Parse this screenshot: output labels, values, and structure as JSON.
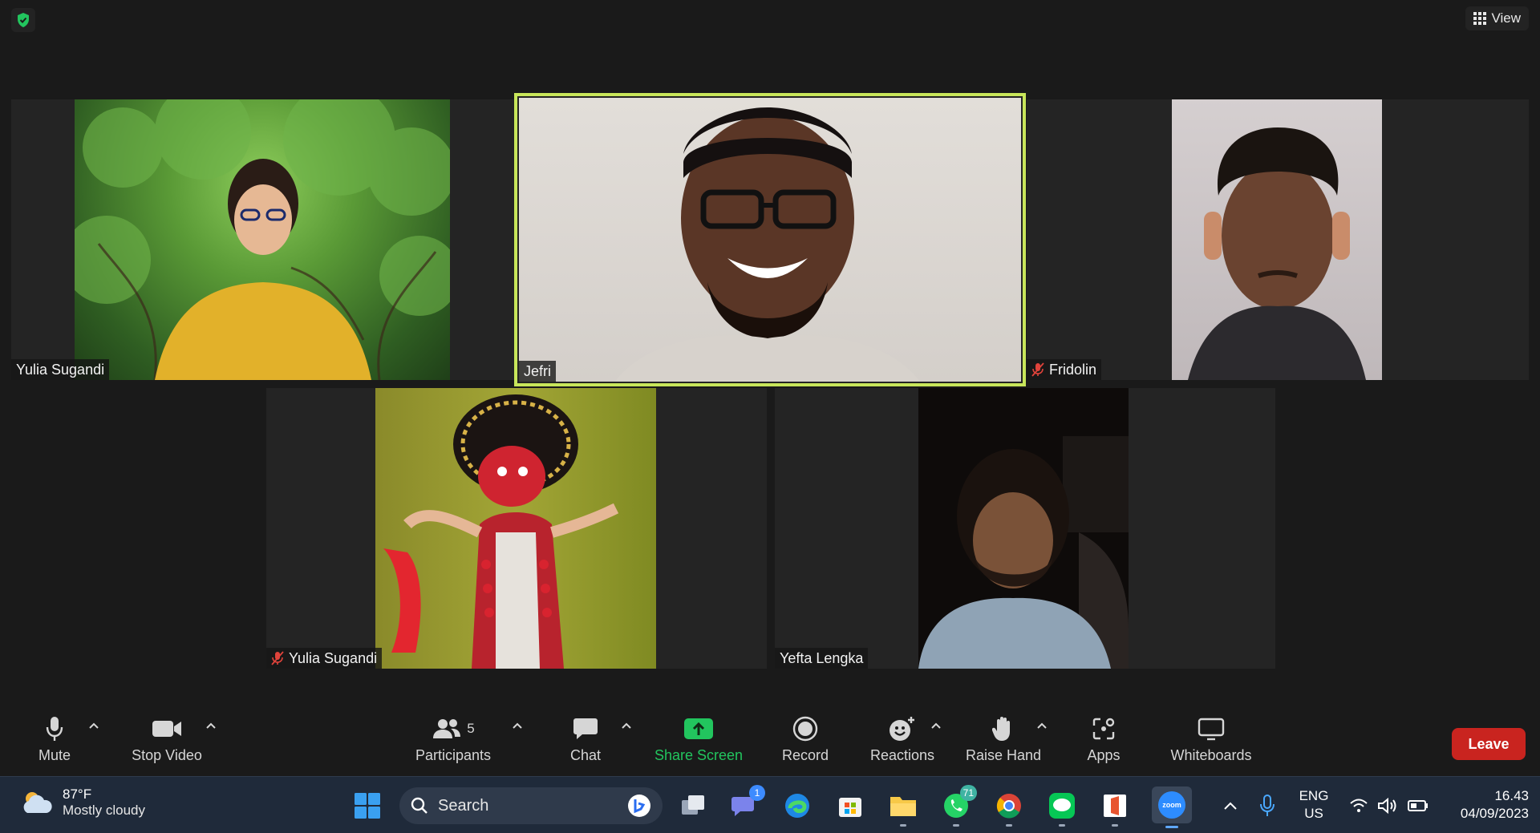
{
  "header": {
    "view_label": "View"
  },
  "participants_tiles": [
    {
      "name": "Yulia Sugandi",
      "muted": false
    },
    {
      "name": "Jefri",
      "muted": false,
      "active_speaker": true
    },
    {
      "name": "Fridolin",
      "muted": true
    },
    {
      "name": "Yulia Sugandi",
      "muted": true
    },
    {
      "name": "Yefta Lengka",
      "muted": false
    }
  ],
  "toolbar": {
    "mute_label": "Mute",
    "stop_video_label": "Stop Video",
    "participants_label": "Participants",
    "participants_count": "5",
    "chat_label": "Chat",
    "share_screen_label": "Share Screen",
    "record_label": "Record",
    "reactions_label": "Reactions",
    "raise_hand_label": "Raise Hand",
    "apps_label": "Apps",
    "whiteboards_label": "Whiteboards",
    "leave_label": "Leave"
  },
  "taskbar": {
    "weather_temp": "87°F",
    "weather_desc": "Mostly cloudy",
    "search_placeholder": "Search",
    "teams_badge": "1",
    "whatsapp_badge": "71",
    "zoom_label": "zoom",
    "lang_line1": "ENG",
    "lang_line2": "US",
    "time": "16.43",
    "date": "04/09/2023"
  },
  "colors": {
    "active_speaker": "#c8e65a",
    "share_green": "#22c55e",
    "leave_red": "#c9241f",
    "taskbar": "#1f2a3a"
  }
}
